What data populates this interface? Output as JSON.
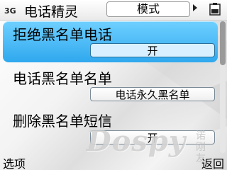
{
  "status_bar": {
    "network_indicator": "3G",
    "app_title": "电话精灵",
    "tab_label": "模式",
    "tab_arrow_icon": "chevron-right-icon",
    "battery_icon": "battery-icon"
  },
  "settings": [
    {
      "label": "拒绝黑名单电话",
      "value": "开",
      "selected": true
    },
    {
      "label": "电话黑名单名单",
      "value": "电话永久黑名单",
      "selected": false
    },
    {
      "label": "删除黑名单短信",
      "value": "开",
      "selected": false
    }
  ],
  "watermark": {
    "text": "Dospy",
    "sub": "诺刚友"
  },
  "softkeys": {
    "left": "选项",
    "right": "返回"
  },
  "colors": {
    "selection": "#2fa8ee",
    "selection_light": "#6fd0ff"
  }
}
